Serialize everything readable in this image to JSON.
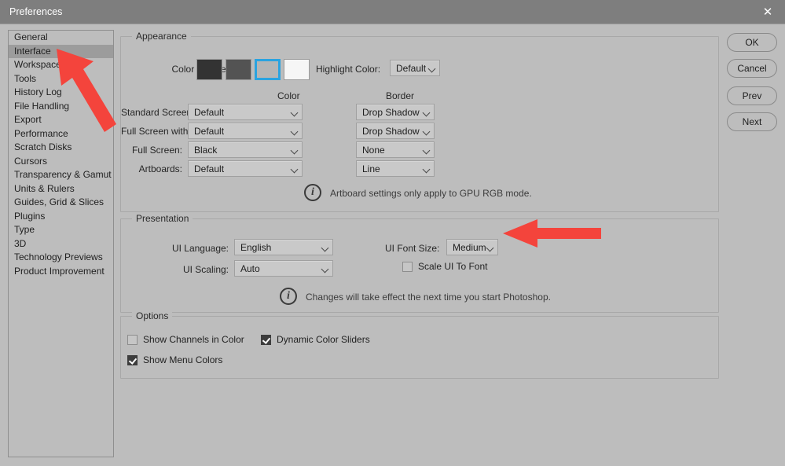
{
  "window": {
    "title": "Preferences",
    "close_icon": "close-icon"
  },
  "sidebar": {
    "items": [
      {
        "label": "General",
        "selected": false
      },
      {
        "label": "Interface",
        "selected": true
      },
      {
        "label": "Workspace",
        "selected": false
      },
      {
        "label": "Tools",
        "selected": false
      },
      {
        "label": "History Log",
        "selected": false
      },
      {
        "label": "File Handling",
        "selected": false
      },
      {
        "label": "Export",
        "selected": false
      },
      {
        "label": "Performance",
        "selected": false
      },
      {
        "label": "Scratch Disks",
        "selected": false
      },
      {
        "label": "Cursors",
        "selected": false
      },
      {
        "label": "Transparency & Gamut",
        "selected": false
      },
      {
        "label": "Units & Rulers",
        "selected": false
      },
      {
        "label": "Guides, Grid & Slices",
        "selected": false
      },
      {
        "label": "Plugins",
        "selected": false
      },
      {
        "label": "Type",
        "selected": false
      },
      {
        "label": "3D",
        "selected": false
      },
      {
        "label": "Technology Previews",
        "selected": false
      },
      {
        "label": "Product Improvement",
        "selected": false
      }
    ]
  },
  "appearance": {
    "group_title": "Appearance",
    "color_theme_label": "Color Theme:",
    "themes": [
      {
        "name": "darkest",
        "color": "#333333",
        "selected": false
      },
      {
        "name": "dark",
        "color": "#535353",
        "selected": false
      },
      {
        "name": "medium",
        "color": "#b5b5b5",
        "selected": true
      },
      {
        "name": "light",
        "color": "#f6f6f6",
        "selected": false
      }
    ],
    "highlight_color_label": "Highlight Color:",
    "highlight_color_value": "Default",
    "column_color": "Color",
    "column_border": "Border",
    "rows": [
      {
        "label": "Standard Screen Mode:",
        "color": "Default",
        "border": "Drop Shadow"
      },
      {
        "label": "Full Screen with Menus:",
        "color": "Default",
        "border": "Drop Shadow"
      },
      {
        "label": "Full Screen:",
        "color": "Black",
        "border": "None"
      },
      {
        "label": "Artboards:",
        "color": "Default",
        "border": "Line"
      }
    ],
    "note": "Artboard settings only apply to GPU RGB mode.",
    "note_icon": "info-icon"
  },
  "presentation": {
    "group_title": "Presentation",
    "ui_language_label": "UI Language:",
    "ui_language_value": "English",
    "ui_scaling_label": "UI Scaling:",
    "ui_scaling_value": "Auto",
    "ui_font_size_label": "UI Font Size:",
    "ui_font_size_value": "Medium",
    "scale_ui_to_font_label": "Scale UI To Font",
    "scale_ui_to_font_checked": false,
    "note": "Changes will take effect the next time you start Photoshop.",
    "note_icon": "info-icon"
  },
  "options": {
    "group_title": "Options",
    "items": [
      {
        "label": "Show Channels in Color",
        "checked": false
      },
      {
        "label": "Dynamic Color Sliders",
        "checked": true
      },
      {
        "label": "Show Menu Colors",
        "checked": true
      }
    ]
  },
  "buttons": [
    {
      "label": "OK"
    },
    {
      "label": "Cancel"
    },
    {
      "label": "Prev"
    },
    {
      "label": "Next"
    }
  ],
  "annotations": {
    "arrow_color": "#f4443c",
    "arrows": [
      {
        "name": "arrow-pointing-to-interface",
        "target": "Interface"
      },
      {
        "name": "arrow-pointing-to-ui-font-size",
        "target": "UI Font Size"
      }
    ]
  }
}
